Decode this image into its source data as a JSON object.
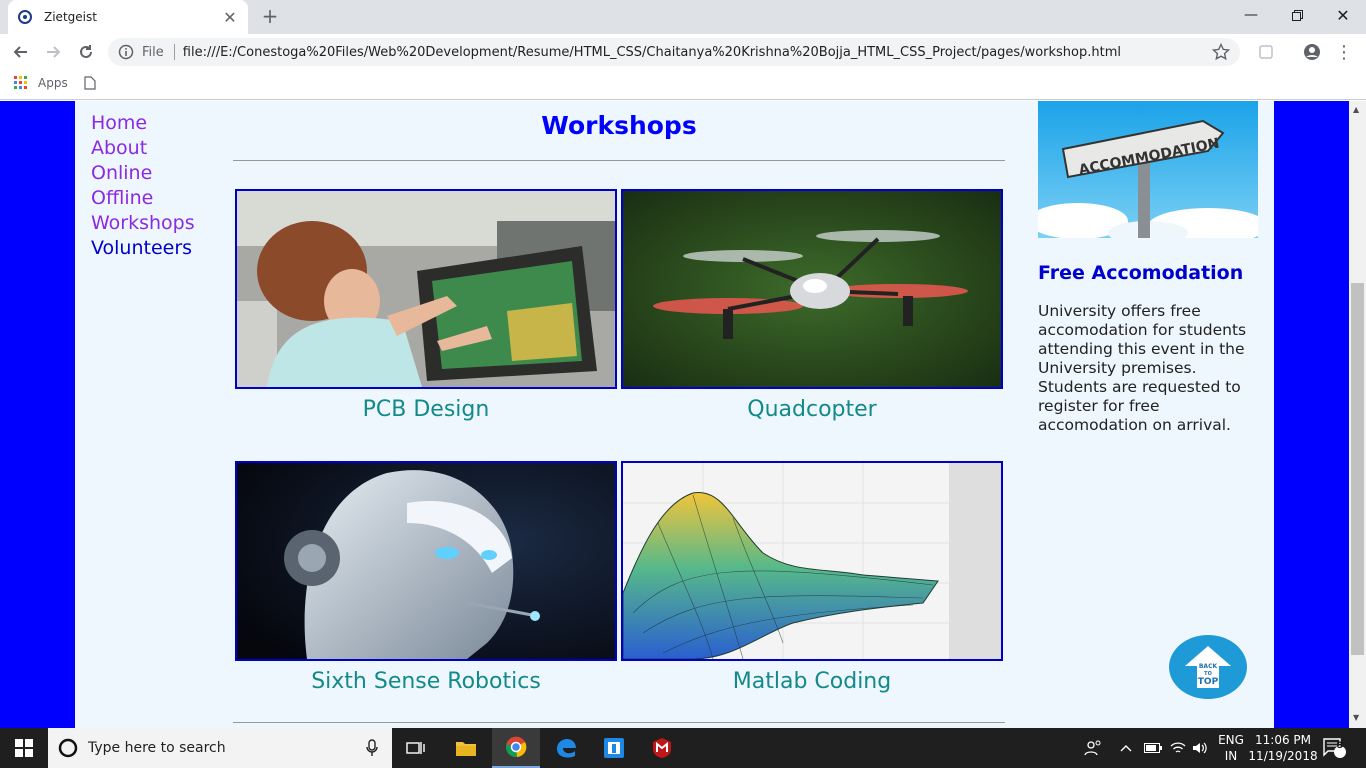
{
  "browser": {
    "tab_title": "Zietgeist",
    "tab_close": "✕",
    "new_tab": "+",
    "protocol": "File",
    "url": "file:///E:/Conestoga%20Files/Web%20Development/Resume/HTML_CSS/Chaitanya%20Krishna%20Bojja_HTML_CSS_Project/pages/workshop.html",
    "bookmarks_apps": "Apps"
  },
  "nav": {
    "items": [
      {
        "label": "Home"
      },
      {
        "label": "About"
      },
      {
        "label": "Online"
      },
      {
        "label": "Offline"
      },
      {
        "label": "Workshops"
      },
      {
        "label": "Volunteers"
      }
    ]
  },
  "main": {
    "title": "Workshops",
    "workshops": [
      {
        "caption": "PCB Design"
      },
      {
        "caption": "Quadcopter"
      },
      {
        "caption": "Sixth Sense Robotics"
      },
      {
        "caption": "Matlab Coding"
      }
    ]
  },
  "aside": {
    "sign_text": "ACCOMMODATION",
    "heading": "Free Accomodation",
    "body": "University offers free accomodation for students attending this event in the University premises. Students are requested to register for free accomodation on arrival."
  },
  "back_to_top": {
    "line1": "BACK",
    "line2": "TO",
    "line3": "TOP"
  },
  "taskbar": {
    "search_placeholder": "Type here to search",
    "lang": "ENG",
    "region": "IN",
    "time": "11:06 PM",
    "date": "11/19/2018",
    "notifications": "3"
  },
  "colors": {
    "page_bg": "#0000ff",
    "content_bg": "#eef6fe",
    "nav_link": "#8a2be2",
    "heading": "#0000ff",
    "caption": "#138a8a"
  }
}
